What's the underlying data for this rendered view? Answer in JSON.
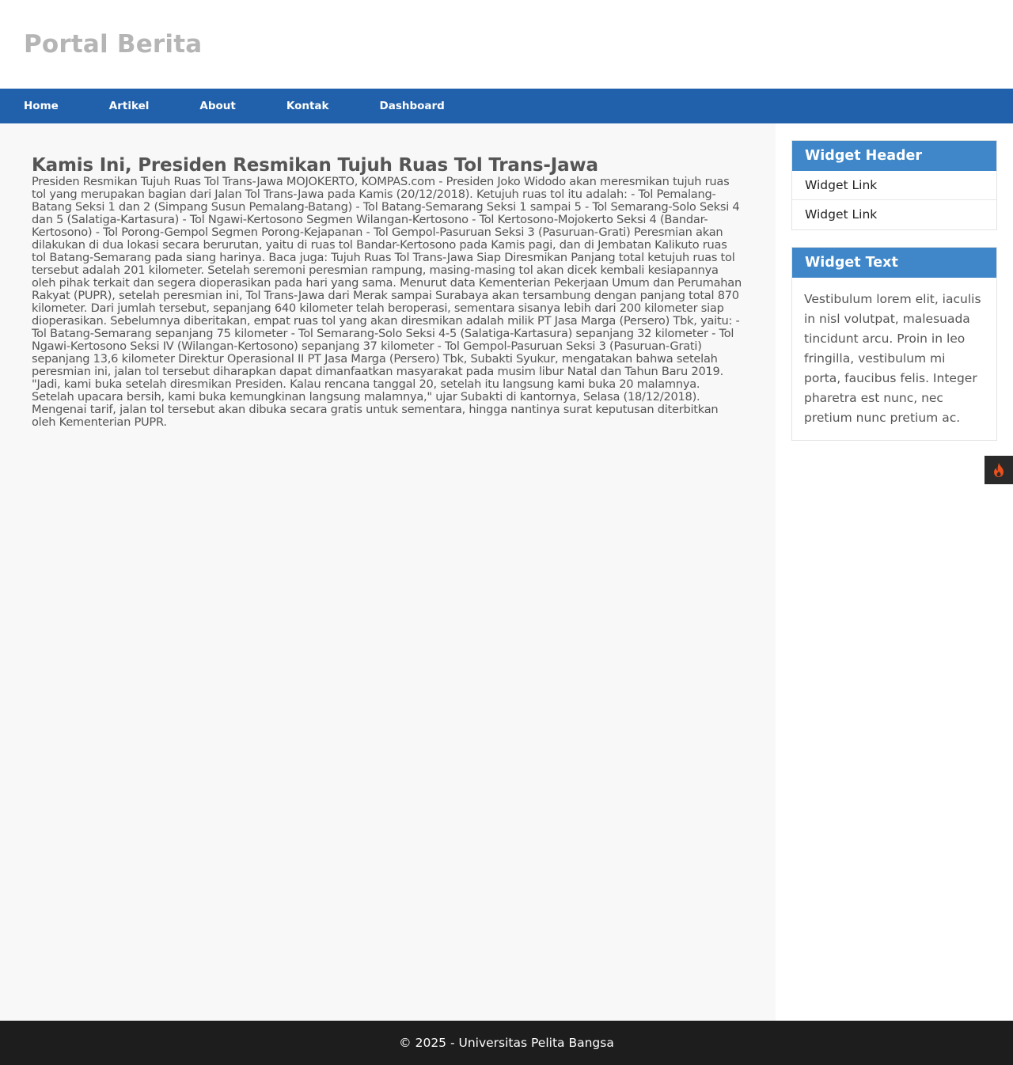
{
  "site": {
    "title": "Portal Berita"
  },
  "nav": {
    "items": [
      {
        "label": "Home"
      },
      {
        "label": "Artikel"
      },
      {
        "label": "About"
      },
      {
        "label": "Kontak"
      },
      {
        "label": "Dashboard"
      }
    ]
  },
  "article": {
    "title": "Kamis Ini, Presiden Resmikan Tujuh Ruas Tol Trans-Jawa",
    "body": "Presiden Resmikan Tujuh Ruas Tol Trans-Jawa MOJOKERTO, KOMPAS.com - Presiden Joko Widodo akan meresmikan tujuh ruas tol yang merupakan bagian dari Jalan Tol Trans-Jawa pada Kamis (20/12/2018). Ketujuh ruas tol itu adalah: - Tol Pemalang-Batang Seksi 1 dan 2 (Simpang Susun Pemalang-Batang) - Tol Batang-Semarang Seksi 1 sampai 5 - Tol Semarang-Solo Seksi 4 dan 5 (Salatiga-Kartasura) - Tol Ngawi-Kertosono Segmen Wilangan-Kertosono - Tol Kertosono-Mojokerto Seksi 4 (Bandar-Kertosono) - Tol Porong-Gempol Segmen Porong-Kejapanan - Tol Gempol-Pasuruan Seksi 3 (Pasuruan-Grati) Peresmian akan dilakukan di dua lokasi secara berurutan, yaitu di ruas tol Bandar-Kertosono pada Kamis pagi, dan di Jembatan Kalikuto ruas tol Batang-Semarang pada siang harinya. Baca juga: Tujuh Ruas Tol Trans-Jawa Siap Diresmikan Panjang total ketujuh ruas tol tersebut adalah 201 kilometer. Setelah seremoni peresmian rampung, masing-masing tol akan dicek kembali kesiapannya oleh pihak terkait dan segera dioperasikan pada hari yang sama. Menurut data Kementerian Pekerjaan Umum dan Perumahan Rakyat (PUPR), setelah peresmian ini, Tol Trans-Jawa dari Merak sampai Surabaya akan tersambung dengan panjang total 870 kilometer. Dari jumlah tersebut, sepanjang 640 kilometer telah beroperasi, sementara sisanya lebih dari 200 kilometer siap dioperasikan. Sebelumnya diberitakan, empat ruas tol yang akan diresmikan adalah milik PT Jasa Marga (Persero) Tbk, yaitu: - Tol Batang-Semarang sepanjang 75 kilometer - Tol Semarang-Solo Seksi 4-5 (Salatiga-Kartasura) sepanjang 32 kilometer - Tol Ngawi-Kertosono Seksi IV (Wilangan-Kertosono) sepanjang 37 kilometer - Tol Gempol-Pasuruan Seksi 3 (Pasuruan-Grati) sepanjang 13,6 kilometer Direktur Operasional II PT Jasa Marga (Persero) Tbk, Subakti Syukur, mengatakan bahwa setelah peresmian ini, jalan tol tersebut diharapkan dapat dimanfaatkan masyarakat pada musim libur Natal dan Tahun Baru 2019. \"Jadi, kami buka setelah diresmikan Presiden. Kalau rencana tanggal 20, setelah itu langsung kami buka 20 malamnya. Setelah upacara bersih, kami buka kemungkinan langsung malamnya,\" ujar Subakti di kantornya, Selasa (18/12/2018). Mengenai tarif, jalan tol tersebut akan dibuka secara gratis untuk sementara, hingga nantinya surat keputusan diterbitkan oleh Kementerian PUPR."
  },
  "sidebar": {
    "widget_header": {
      "title": "Widget Header",
      "links": [
        {
          "label": "Widget Link"
        },
        {
          "label": "Widget Link"
        }
      ]
    },
    "widget_text": {
      "title": "Widget Text",
      "text": "Vestibulum lorem elit, iaculis in nisl volutpat, malesuada tincidunt arcu. Proin in leo fringilla, vestibulum mi porta, faucibus felis. Integer pharetra est nunc, nec pretium nunc pretium ac."
    }
  },
  "floating_button": {
    "icon": "flame-icon",
    "color": "#e8501e"
  },
  "footer": {
    "text": "© 2025 - Universitas Pelita Bangsa"
  },
  "colors": {
    "nav_bg": "#2161ab",
    "widget_header_bg": "#3f87c9",
    "footer_bg": "#1d1d1d",
    "title_gray": "#b5b5b5"
  }
}
